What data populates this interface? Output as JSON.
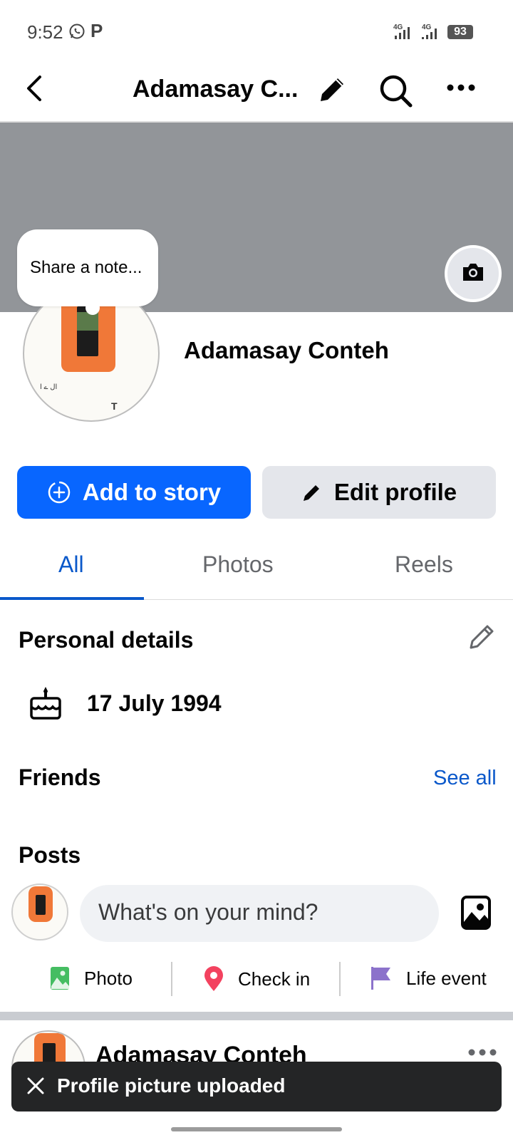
{
  "status_bar": {
    "time": "9:52",
    "network1": "4G",
    "network2": "4G",
    "battery": "93"
  },
  "header": {
    "title": "Adamasay C..."
  },
  "note": {
    "placeholder": "Share a note..."
  },
  "profile": {
    "name": "Adamasay Conteh"
  },
  "buttons": {
    "add_story": "Add to story",
    "edit_profile": "Edit profile"
  },
  "tabs": [
    {
      "label": "All",
      "selected": true
    },
    {
      "label": "Photos"
    },
    {
      "label": "Reels"
    }
  ],
  "personal_details": {
    "title": "Personal details",
    "birthday": "17 July 1994"
  },
  "friends": {
    "title": "Friends",
    "see_all": "See all"
  },
  "posts": {
    "title": "Posts",
    "composer_placeholder": "What's on your mind?",
    "actions": [
      {
        "label": "Photo",
        "icon": "photo-icon"
      },
      {
        "label": "Check in",
        "icon": "location-pin-icon"
      },
      {
        "label": "Life event",
        "icon": "flag-icon"
      }
    ],
    "first_post_author": "Adamasay Conteh"
  },
  "toast": {
    "message": "Profile picture uploaded"
  },
  "colors": {
    "primary": "#0866ff",
    "link": "#0a58ca",
    "cover": "#929599"
  }
}
